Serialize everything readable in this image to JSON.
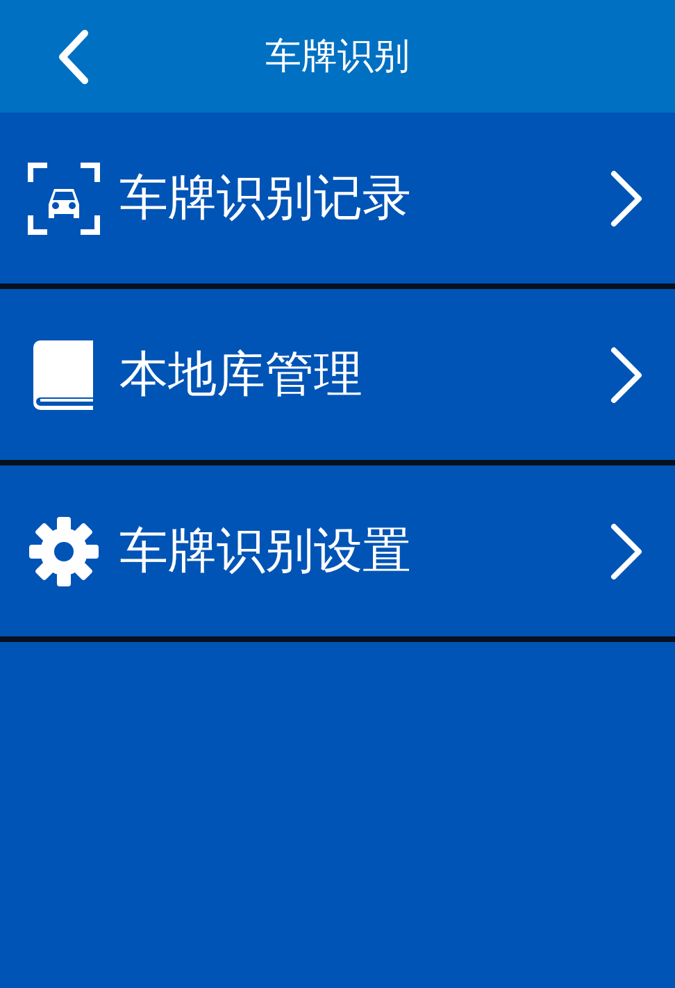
{
  "header": {
    "title": "车牌识别"
  },
  "items": [
    {
      "kind": "record",
      "label": "车牌识别记录"
    },
    {
      "kind": "library",
      "label": "本地库管理"
    },
    {
      "kind": "settings",
      "label": "车牌识别设置"
    }
  ]
}
